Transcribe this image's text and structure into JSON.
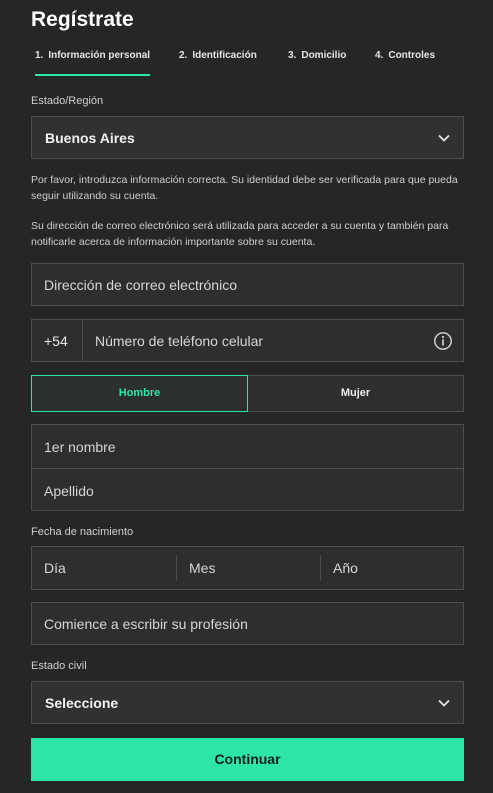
{
  "page": {
    "title": "Regístrate"
  },
  "tabs": [
    {
      "num": "1.",
      "label": "Información personal",
      "active": true
    },
    {
      "num": "2.",
      "label": "Identificación"
    },
    {
      "num": "3.",
      "label": "Domicilio"
    },
    {
      "num": "4.",
      "label": "Controles"
    }
  ],
  "region": {
    "label": "Estado/Región",
    "value": "Buenos Aires",
    "icon": "chevron-down-icon"
  },
  "help": {
    "identity": "Por favor, introduzca información correcta. Su identidad debe ser verificada para que pueda seguir utilizando su cuenta.",
    "email": "Su dirección de correo electrónico será utilizada para acceder a su cuenta y también para notificarle acerca de información importante sobre su cuenta."
  },
  "email": {
    "placeholder": "Dirección de correo electrónico"
  },
  "phone": {
    "prefix": "+54",
    "placeholder": "Número de teléfono celular",
    "icon": "info-icon"
  },
  "gender": {
    "male": "Hombre",
    "female": "Mujer",
    "selected": "Hombre"
  },
  "names": {
    "first_placeholder": "1er nombre",
    "last_placeholder": "Apellido"
  },
  "birth": {
    "label": "Fecha de nacimiento",
    "day_placeholder": "Día",
    "month_placeholder": "Mes",
    "year_placeholder": "Año"
  },
  "profession": {
    "placeholder": "Comience a escribir su profesión"
  },
  "marital": {
    "label": "Estado civil",
    "value": "Seleccione",
    "icon": "chevron-down-icon"
  },
  "continue_label": "Continuar",
  "colors": {
    "accent": "#2fe6aa",
    "background": "#242726",
    "field": "#2c2f2e",
    "border": "#4b4e4d"
  }
}
